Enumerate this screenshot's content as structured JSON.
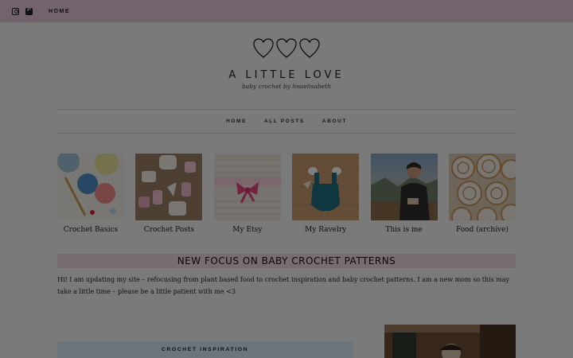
{
  "topbar": {
    "icons": [
      "instagram-icon",
      "pinterest-icon"
    ],
    "home_label": "HOME",
    "color": "#e7c6d8"
  },
  "header": {
    "hearts_count": 3,
    "title": "A LITTLE LOVE",
    "tagline": "baby crochet by linaelisabeth"
  },
  "nav": {
    "items": [
      "HOME",
      "ALL POSTS",
      "ABOUT"
    ]
  },
  "tiles": [
    {
      "label": "Crochet Basics"
    },
    {
      "label": "Crochet Posts"
    },
    {
      "label": "My Etsy"
    },
    {
      "label": "My Ravelry"
    },
    {
      "label": "This is me"
    },
    {
      "label": "Food (archive)"
    }
  ],
  "focus": {
    "heading": "NEW FOCUS ON BABY CROCHET PATTERNS",
    "text": "Hi! I am updating my site – refocusing from plant based food to crochet inspiration and baby crochet patterns. I am a new mom so this may take a little time – please be a little patient with me <3"
  },
  "bottom": {
    "inspiration_label": "CROCHET INSPIRATION"
  },
  "colors": {
    "accent_pink": "#e7c6d8",
    "focus_bg": "#f1dde5",
    "inspiration_bg": "#d6ebf7",
    "overlay": "rgba(0,0,0,0.5)"
  }
}
